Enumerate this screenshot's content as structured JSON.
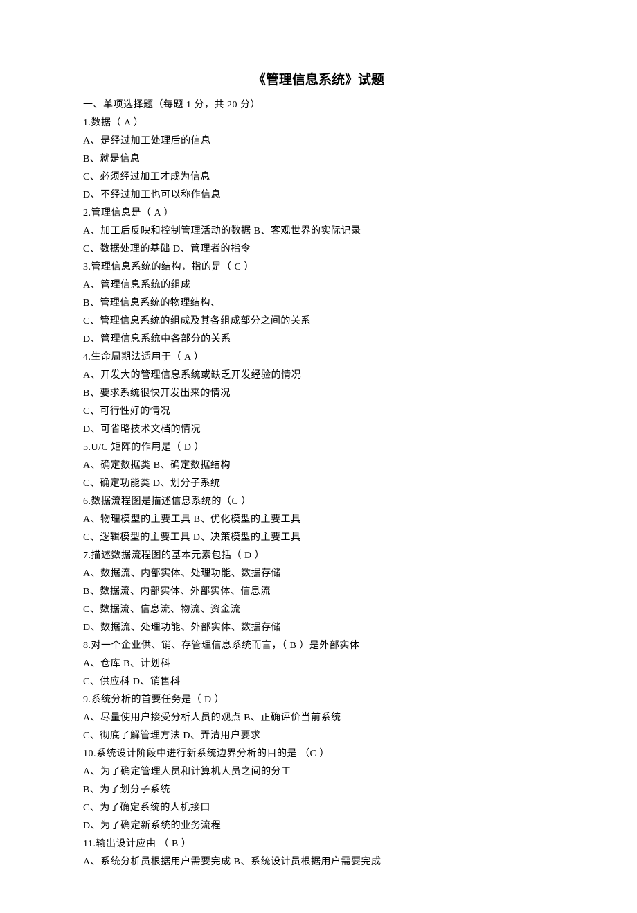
{
  "title": "《管理信息系统》试题",
  "lines": [
    "一、单项选择题（每题 1 分，共 20 分）",
    "1.数据（ A   ）",
    "A、是经过加工处理后的信息",
    "B、就是信息",
    "C、必须经过加工才成为信息",
    "D、不经过加工也可以称作信息",
    "2.管理信息是（  A  ）",
    "A、加工后反映和控制管理活动的数据 B、客观世界的实际记录",
    "C、数据处理的基础 D、管理者的指令",
    "3.管理信息系统的结构，指的是（  C  ）",
    "A、管理信息系统的组成",
    "B、管理信息系统的物理结构、",
    "C、管理信息系统的组成及其各组成部分之间的关系",
    "D、管理信息系统中各部分的关系",
    "4.生命周期法适用于（ A   ）",
    "A、开发大的管理信息系统或缺乏开发经验的情况",
    "B、要求系统很快开发出来的情况",
    "C、可行性好的情况",
    "D、可省略技术文档的情况",
    "5.U/C 矩阵的作用是（  D  ）",
    "A、确定数据类 B、确定数据结构",
    "C、确定功能类 D、划分子系统",
    "6.数据流程图是描述信息系统的（C    ）",
    "A、物理模型的主要工具 B、优化模型的主要工具",
    "C、逻辑模型的主要工具 D、决策模型的主要工具",
    "7.描述数据流程图的基本元素包括（ D   ）",
    "A、数据流、内部实体、处理功能、数据存储",
    "B、数据流、内部实体、外部实体、信息流",
    "C、数据流、信息流、物流、资金流",
    "D、数据流、处理功能、外部实体、数据存储",
    "8.对一个企业供、销、存管理信息系统而言，（ B   ）是外部实体",
    "A、仓库 B、计划科",
    "C、供应科 D、销售科",
    "9.系统分析的首要任务是（ D   ）",
    "A、尽量使用户接受分析人员的观点 B、正确评价当前系统",
    "C、彻底了解管理方法 D、弄清用户要求",
    "10.系统设计阶段中进行新系统边界分析的目的是 （C    ）",
    "A、为了确定管理人员和计算机人员之间的分工",
    "B、为了划分子系统",
    "C、为了确定系统的人机接口",
    "D、为了确定新系统的业务流程",
    "11.输出设计应由 （ B   ）",
    "A、系统分析员根据用户需要完成 B、系统设计员根据用户需要完成"
  ]
}
